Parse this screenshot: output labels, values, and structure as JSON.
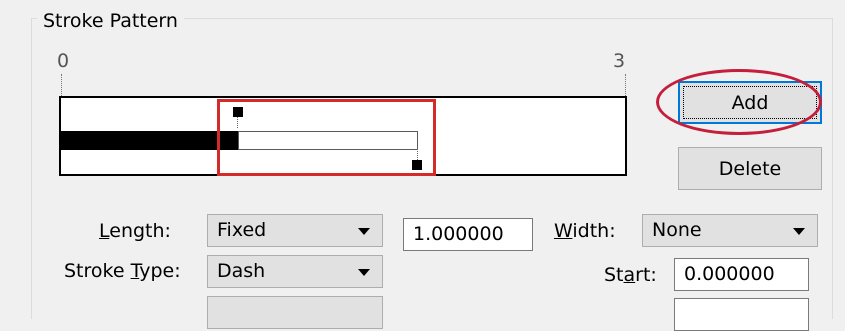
{
  "group": {
    "title": "Stroke Pattern"
  },
  "scale": {
    "min_label": "0",
    "max_label": "3"
  },
  "buttons": {
    "add": "Add",
    "delete": "Delete"
  },
  "length": {
    "label_prefix": "",
    "label_mnemonic": "L",
    "label_suffix": "ength:",
    "value": "Fixed",
    "amount": "1.000000"
  },
  "width": {
    "label_prefix": "",
    "label_mnemonic": "W",
    "label_suffix": "idth:",
    "value": "None"
  },
  "stroke_type": {
    "label_prefix": "Stroke ",
    "label_mnemonic": "T",
    "label_suffix": "ype:",
    "value": "Dash"
  },
  "start": {
    "label_prefix": "St",
    "label_mnemonic": "a",
    "label_suffix": "rt:",
    "value": "0.000000"
  },
  "colors": {
    "annotation_red": "#d42a2a",
    "focus_blue": "#0078d7"
  }
}
